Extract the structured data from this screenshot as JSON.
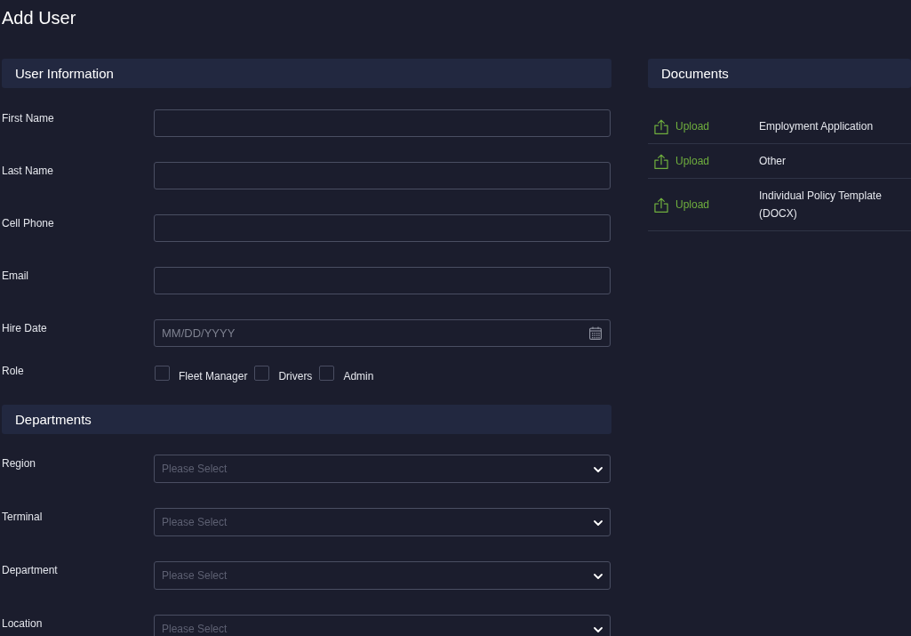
{
  "page": {
    "title": "Add User"
  },
  "form_sections": [
    {
      "title": "User Information",
      "fields": [
        {
          "kind": "text",
          "label": "First Name"
        },
        {
          "kind": "text",
          "label": "Last Name"
        },
        {
          "kind": "text",
          "label": "Cell Phone"
        },
        {
          "kind": "text",
          "label": "Email"
        },
        {
          "kind": "date",
          "label": "Hire Date",
          "placeholder": "MM/DD/YYYY"
        },
        {
          "kind": "checkboxes",
          "label": "Role",
          "options": [
            {
              "label": "Fleet Manager",
              "checked": false
            },
            {
              "label": "Drivers",
              "checked": false
            },
            {
              "label": "Admin",
              "checked": false
            }
          ]
        }
      ]
    },
    {
      "title": "Departments",
      "fields": [
        {
          "kind": "select",
          "label": "Region",
          "placeholder": "Please Select"
        },
        {
          "kind": "select",
          "label": "Terminal",
          "placeholder": "Please Select"
        },
        {
          "kind": "select",
          "label": "Department",
          "placeholder": "Please Select"
        },
        {
          "kind": "select",
          "label": "Location",
          "placeholder": "Please Select"
        }
      ]
    }
  ],
  "documents": {
    "title": "Documents",
    "rows": [
      {
        "action": "Upload",
        "name": "Employment Application"
      },
      {
        "action": "Upload",
        "name": "Other"
      },
      {
        "action": "Upload",
        "name": "Individual Policy Template (DOCX)"
      }
    ]
  }
}
